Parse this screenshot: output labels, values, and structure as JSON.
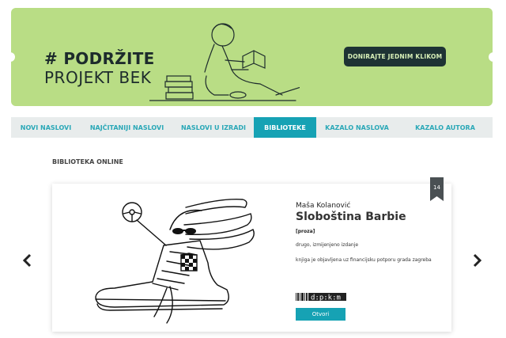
{
  "banner": {
    "title": "# PODRŽITE",
    "subtitle": "PROJEKT BEK",
    "donate_label": "DONIRAJTE JEDNIM KLIKOM",
    "background": "#b9dd85",
    "button_color": "#1e3334"
  },
  "nav": {
    "items": [
      {
        "label": "NOVI NASLOVI"
      },
      {
        "label": "NAJČITANIJI NASLOVI"
      },
      {
        "label": "NASLOVI U IZRADI"
      },
      {
        "label": "BIBLIOTEKE",
        "active": true
      },
      {
        "label": "KAZALO NASLOVA"
      },
      {
        "label": "KAZALO AUTORA"
      }
    ],
    "accent": "#16a2b4"
  },
  "section": {
    "heading": "BIBLIOTEKA ONLINE"
  },
  "book": {
    "badge_number": "14",
    "author": "Maša Kolanović",
    "title": "Sloboština Barbie",
    "genre": "[proza]",
    "edition": "drugo, izmijenjeno izdanje",
    "support_note": "knjiga je objavljena uz financijsku potporu grada zagreba",
    "publisher_logo_text": "d:p:k:m",
    "open_label": "Otvori"
  },
  "carousel": {
    "prev_icon": "chevron-left-icon",
    "next_icon": "chevron-right-icon"
  }
}
